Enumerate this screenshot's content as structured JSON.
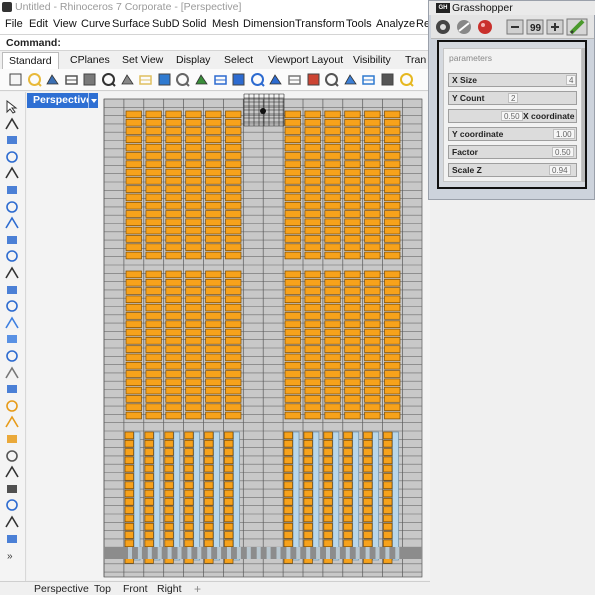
{
  "window": {
    "title": "Untitled - Rhinoceros 7 Corporate - [Perspective]"
  },
  "menu": [
    "File",
    "Edit",
    "View",
    "Curve",
    "Surface",
    "SubD",
    "Solid",
    "Mesh",
    "Dimension",
    "Transform",
    "Tools",
    "Analyze",
    "Re"
  ],
  "command": {
    "label": "Command:"
  },
  "tabs": [
    "Standard",
    "CPlanes",
    "Set View",
    "Display",
    "Select",
    "Viewport Layout",
    "Visibility",
    "Tran"
  ],
  "active_tab": "Standard",
  "viewport": {
    "label": "Perspective",
    "bottom_tabs": [
      "Perspective",
      "Top",
      "Front",
      "Right"
    ],
    "bottom_tabs_add": "+"
  },
  "grasshopper": {
    "title": "Grasshopper",
    "group_title": "parameters",
    "sliders": [
      {
        "name": "X Size",
        "value": "4"
      },
      {
        "name": "Y Count",
        "value": "2"
      },
      {
        "name": "X coordinate",
        "value": "0.50"
      },
      {
        "name": "Y coordinate",
        "value": "1.00"
      },
      {
        "name": "Factor",
        "value": "0.50"
      },
      {
        "name": "Scale Z",
        "value": "0.94"
      }
    ]
  },
  "colors": {
    "accent_blue": "#2e6fd3",
    "panel_orange": "#f7a21b",
    "frame_grey": "#c8c8c8",
    "glass_blue": "#b9d7ea"
  },
  "icons": {
    "toolbar": [
      "new-file-icon",
      "open-file-icon",
      "save-icon",
      "print-icon",
      "import-icon",
      "cut-icon",
      "copy-icon",
      "paste-icon",
      "undo-icon",
      "pan-icon",
      "rotate-view-icon",
      "zoom-icon",
      "zoom-window-icon",
      "zoom-extents-icon",
      "zoom-selected-icon",
      "grid-icon",
      "car-icon",
      "shade-icon",
      "render-icon",
      "sphere-icon",
      "lock-icon",
      "light-bulb-icon"
    ],
    "left": [
      "pointer-icon",
      "point-icon",
      "polyline-icon",
      "curve-icon",
      "circle-icon",
      "ellipse-icon",
      "polygon-icon",
      "rectangle-icon",
      "arc-icon",
      "fillet-icon",
      "offset-icon",
      "surface-icon",
      "extrude-icon",
      "box-icon",
      "sphere-solid-icon",
      "cylinder-icon",
      "mesh-icon",
      "boolean-icon",
      "transform-icon",
      "array-icon",
      "flow-icon",
      "dimension-icon",
      "text-icon",
      "hatch-icon",
      "annotation-icon",
      "arrow-icon",
      "group-icon",
      "more-icon"
    ]
  }
}
